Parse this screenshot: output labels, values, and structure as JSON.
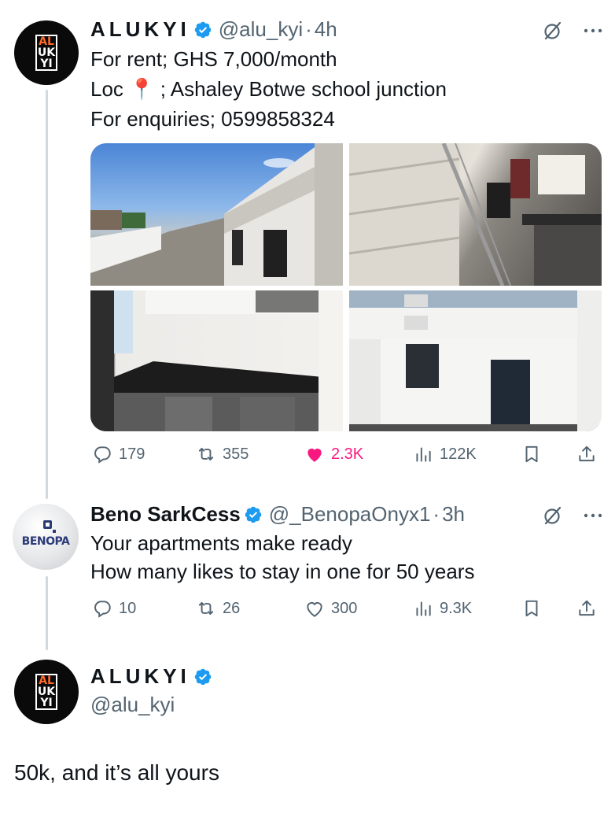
{
  "tweets": [
    {
      "name": "ALUKYI",
      "handle": "@alu_kyi",
      "separator": "·",
      "time": "4h",
      "lines": [
        "For rent; GHS 7,000/month",
        "Loc 📍 ; Ashaley Botwe school junction",
        "For enquiries; 0599858324"
      ],
      "media": [
        "exterior-street-photo",
        "staircase-kitchen-photo",
        "kitchen-counter-photo",
        "house-entrance-photo"
      ],
      "stats": {
        "replies": "179",
        "reposts": "355",
        "likes": "2.3K",
        "views": "122K"
      },
      "liked": true
    },
    {
      "name": "Beno SarkCess",
      "handle": "@_BenopaOnyx1",
      "separator": "·",
      "time": "3h",
      "avatar_label": "BENOPA",
      "lines": [
        "Your apartments make ready",
        "How many likes to stay in one for 50 years"
      ],
      "stats": {
        "replies": "10",
        "reposts": "26",
        "likes": "300",
        "views": "9.3K"
      },
      "liked": false
    },
    {
      "name": "ALUKYI",
      "handle": "@alu_kyi",
      "text": "50k, and it’s all yours"
    }
  ],
  "avatar_logo": {
    "letters": [
      "AL",
      "UK",
      "YI"
    ]
  },
  "colors": {
    "like": "#f91880",
    "verified": "#1d9bf0",
    "muted": "#536471",
    "text": "#0f1419"
  },
  "icons": [
    "verified-badge-icon",
    "grok-icon",
    "more-icon",
    "reply-icon",
    "repost-icon",
    "like-icon",
    "views-icon",
    "bookmark-icon",
    "share-icon"
  ]
}
